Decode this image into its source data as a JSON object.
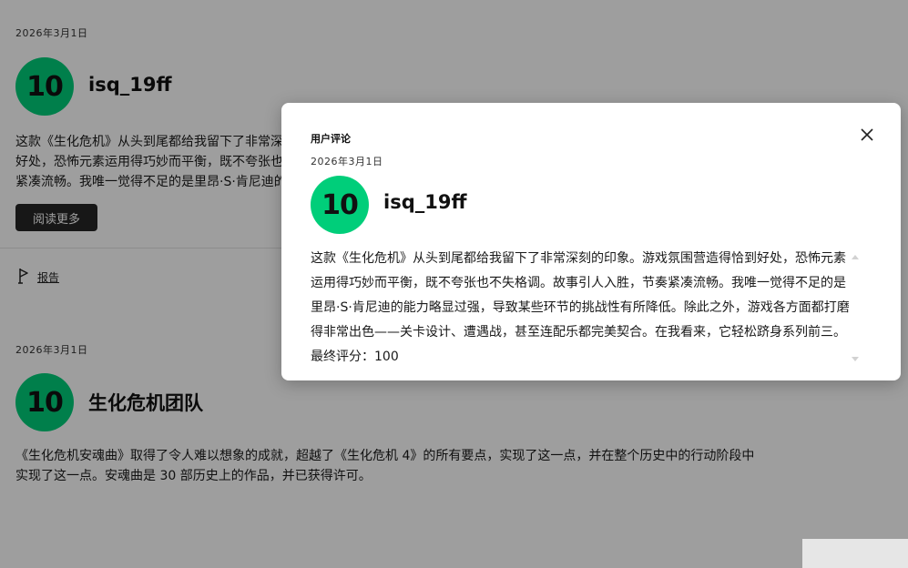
{
  "reviews": [
    {
      "date": "2026年3月1日",
      "score": "10",
      "author": "isq_19ff",
      "excerpt": "这款《生化危机》从头到尾都给我留下了非常深刻的印象。游戏氛围营造得恰到好处，恐怖元素运用得巧妙而平衡，既不夸张也不失格调。故事引人入胜，节奏紧凑流畅。我唯一觉得不足的是里昂·S·肯尼迪的能力略显过强，导致某些环节的挑战性有所降低。除此之外，游戏各方面都打磨得非常出色",
      "read_more_label": "阅读更多",
      "report_label": "报告"
    },
    {
      "date": "2026年3月1日",
      "score": "10",
      "author": "生化危机团队",
      "text": "《生化危机安魂曲》取得了令人难以想象的成就，超越了《生化危机 4》的所有要点，实现了这一点，并在整个历史中的行动阶段中实现了这一点。安魂曲是 30 部历史上的作品，并已获得许可。"
    }
  ],
  "modal": {
    "title": "用户评论",
    "date": "2026年3月1日",
    "score": "10",
    "author": "isq_19ff",
    "text": "这款《生化危机》从头到尾都给我留下了非常深刻的印象。游戏氛围营造得恰到好处，恐怖元素运用得巧妙而平衡，既不夸张也不失格调。故事引人入胜，节奏紧凑流畅。我唯一觉得不足的是里昂·S·肯尼迪的能力略显过强，导致某些环节的挑战性有所降低。除此之外，游戏各方面都打磨得非常出色——关卡设计、遭遇战，甚至连配乐都完美契合。在我看来，它轻松跻身系列前三。最终评分：100"
  },
  "colors": {
    "score_green": "#00ce7a",
    "button_dark": "#262626",
    "overlay": "rgba(0,0,0,0.38)"
  },
  "icons": {
    "close": "close-icon",
    "report": "flag-icon",
    "scroll_up": "chevron-up-icon",
    "scroll_down": "chevron-down-icon"
  }
}
